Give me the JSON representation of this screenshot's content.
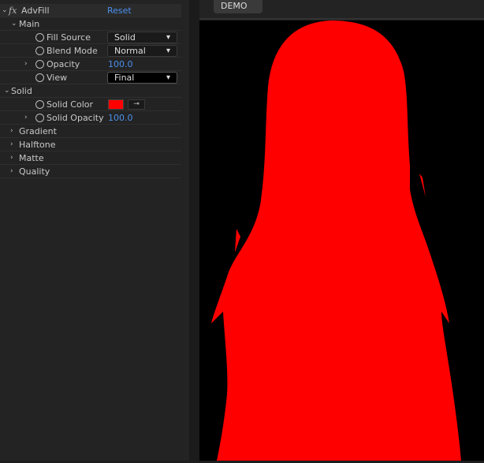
{
  "effect": {
    "name": "AdvFill",
    "reset": "Reset",
    "fx": "fx"
  },
  "groups": {
    "main": {
      "label": "Main",
      "fill_source": {
        "label": "Fill Source",
        "value": "Solid"
      },
      "blend_mode": {
        "label": "Blend Mode",
        "value": "Normal"
      },
      "opacity": {
        "label": "Opacity",
        "value": "100.0"
      },
      "view": {
        "label": "View",
        "value": "Final"
      }
    },
    "solid": {
      "label": "Solid",
      "solid_color": {
        "label": "Solid Color",
        "color": "#ff0000"
      },
      "solid_opacity": {
        "label": "Solid Opacity",
        "value": "100.0"
      }
    },
    "collapsed": [
      "Gradient",
      "Halftone",
      "Matte",
      "Quality"
    ]
  },
  "viewer": {
    "tab": "DEMO",
    "fill_color": "#ff0000"
  }
}
